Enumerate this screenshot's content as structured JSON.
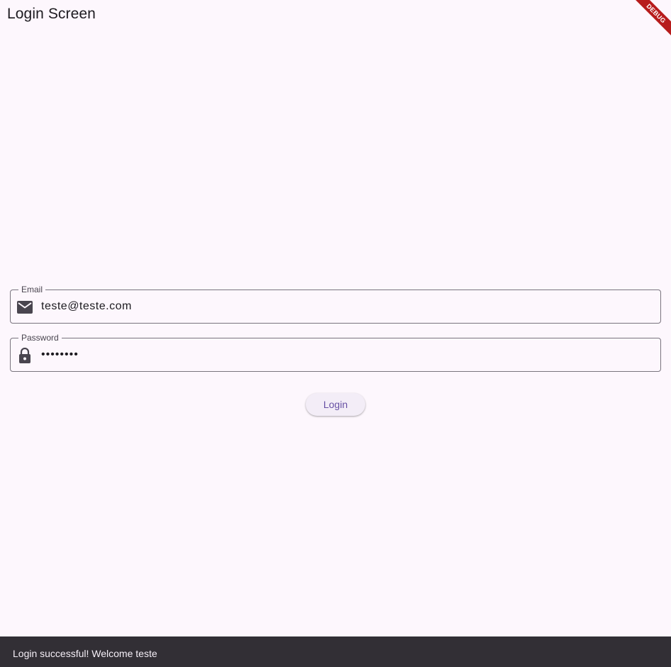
{
  "appbar": {
    "title": "Login Screen"
  },
  "debug_banner": {
    "label": "DEBUG"
  },
  "form": {
    "email": {
      "label": "Email",
      "value": "teste@teste.com",
      "icon": "mail-icon"
    },
    "password": {
      "label": "Password",
      "value": "••••••••",
      "icon": "lock-icon"
    },
    "login_button": "Login"
  },
  "snackbar": {
    "message": "Login successful! Welcome teste"
  },
  "colors": {
    "background": "#fdf7fd",
    "primary": "#6750a4",
    "outline": "#79747e",
    "snackbar_bg": "#322f35",
    "debug_ribbon": "#b71c1c"
  }
}
